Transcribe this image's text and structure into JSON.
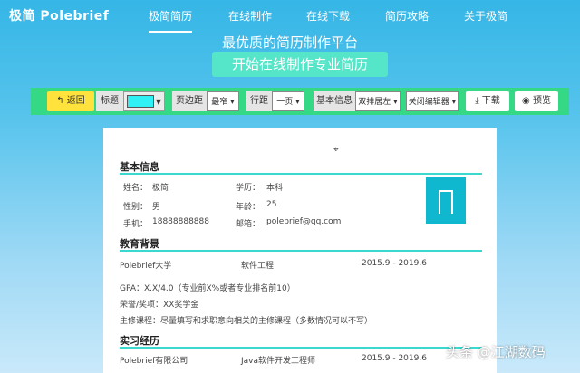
{
  "brand": "极简 Polebrief",
  "nav": [
    "极简简历",
    "在线制作",
    "在线下载",
    "简历攻略",
    "关于极简"
  ],
  "headline": "最优质的简历制作平台",
  "cta": "开始在线制作专业简历",
  "toolbar": {
    "back": "返回",
    "title_label": "标题",
    "title_color": "#2ff0f4",
    "margin_label": "页边距",
    "margin_value": "最窄",
    "spacing_label": "行距",
    "spacing_value": "一页",
    "basic_label": "基本信息",
    "basic_value": "双排居左",
    "editor_value": "关闭编辑器",
    "download": "下载",
    "preview": "预览"
  },
  "resume": {
    "basic_title": "基本信息",
    "fields": {
      "name_label": "姓名：",
      "name": "极简",
      "edu_label": "学历：",
      "edu": "本科",
      "gender_label": "性别：",
      "gender": "男",
      "age_label": "年龄：",
      "age": "25",
      "phone_label": "手机：",
      "phone": "18888888888",
      "email_label": "邮箱：",
      "email": "polebrief@qq.com"
    },
    "education_title": "教育背景",
    "school": "Polebrief大学",
    "major": "软件工程",
    "edu_period": "2015.9 - 2019.6",
    "gpa": "GPA：X.X/4.0（专业前X%或者专业排名前10）",
    "honors": "荣誉/奖项：XX奖学金",
    "courses": "主修课程：尽量填写和求职意向相关的主修课程（多数情况可以不写）",
    "intern_title": "实习经历",
    "company": "Polebrief有限公司",
    "position": "Java软件开发工程师",
    "intern_period": "2015.9 - 2019.6"
  },
  "watermark": "头条 @江湖数码"
}
